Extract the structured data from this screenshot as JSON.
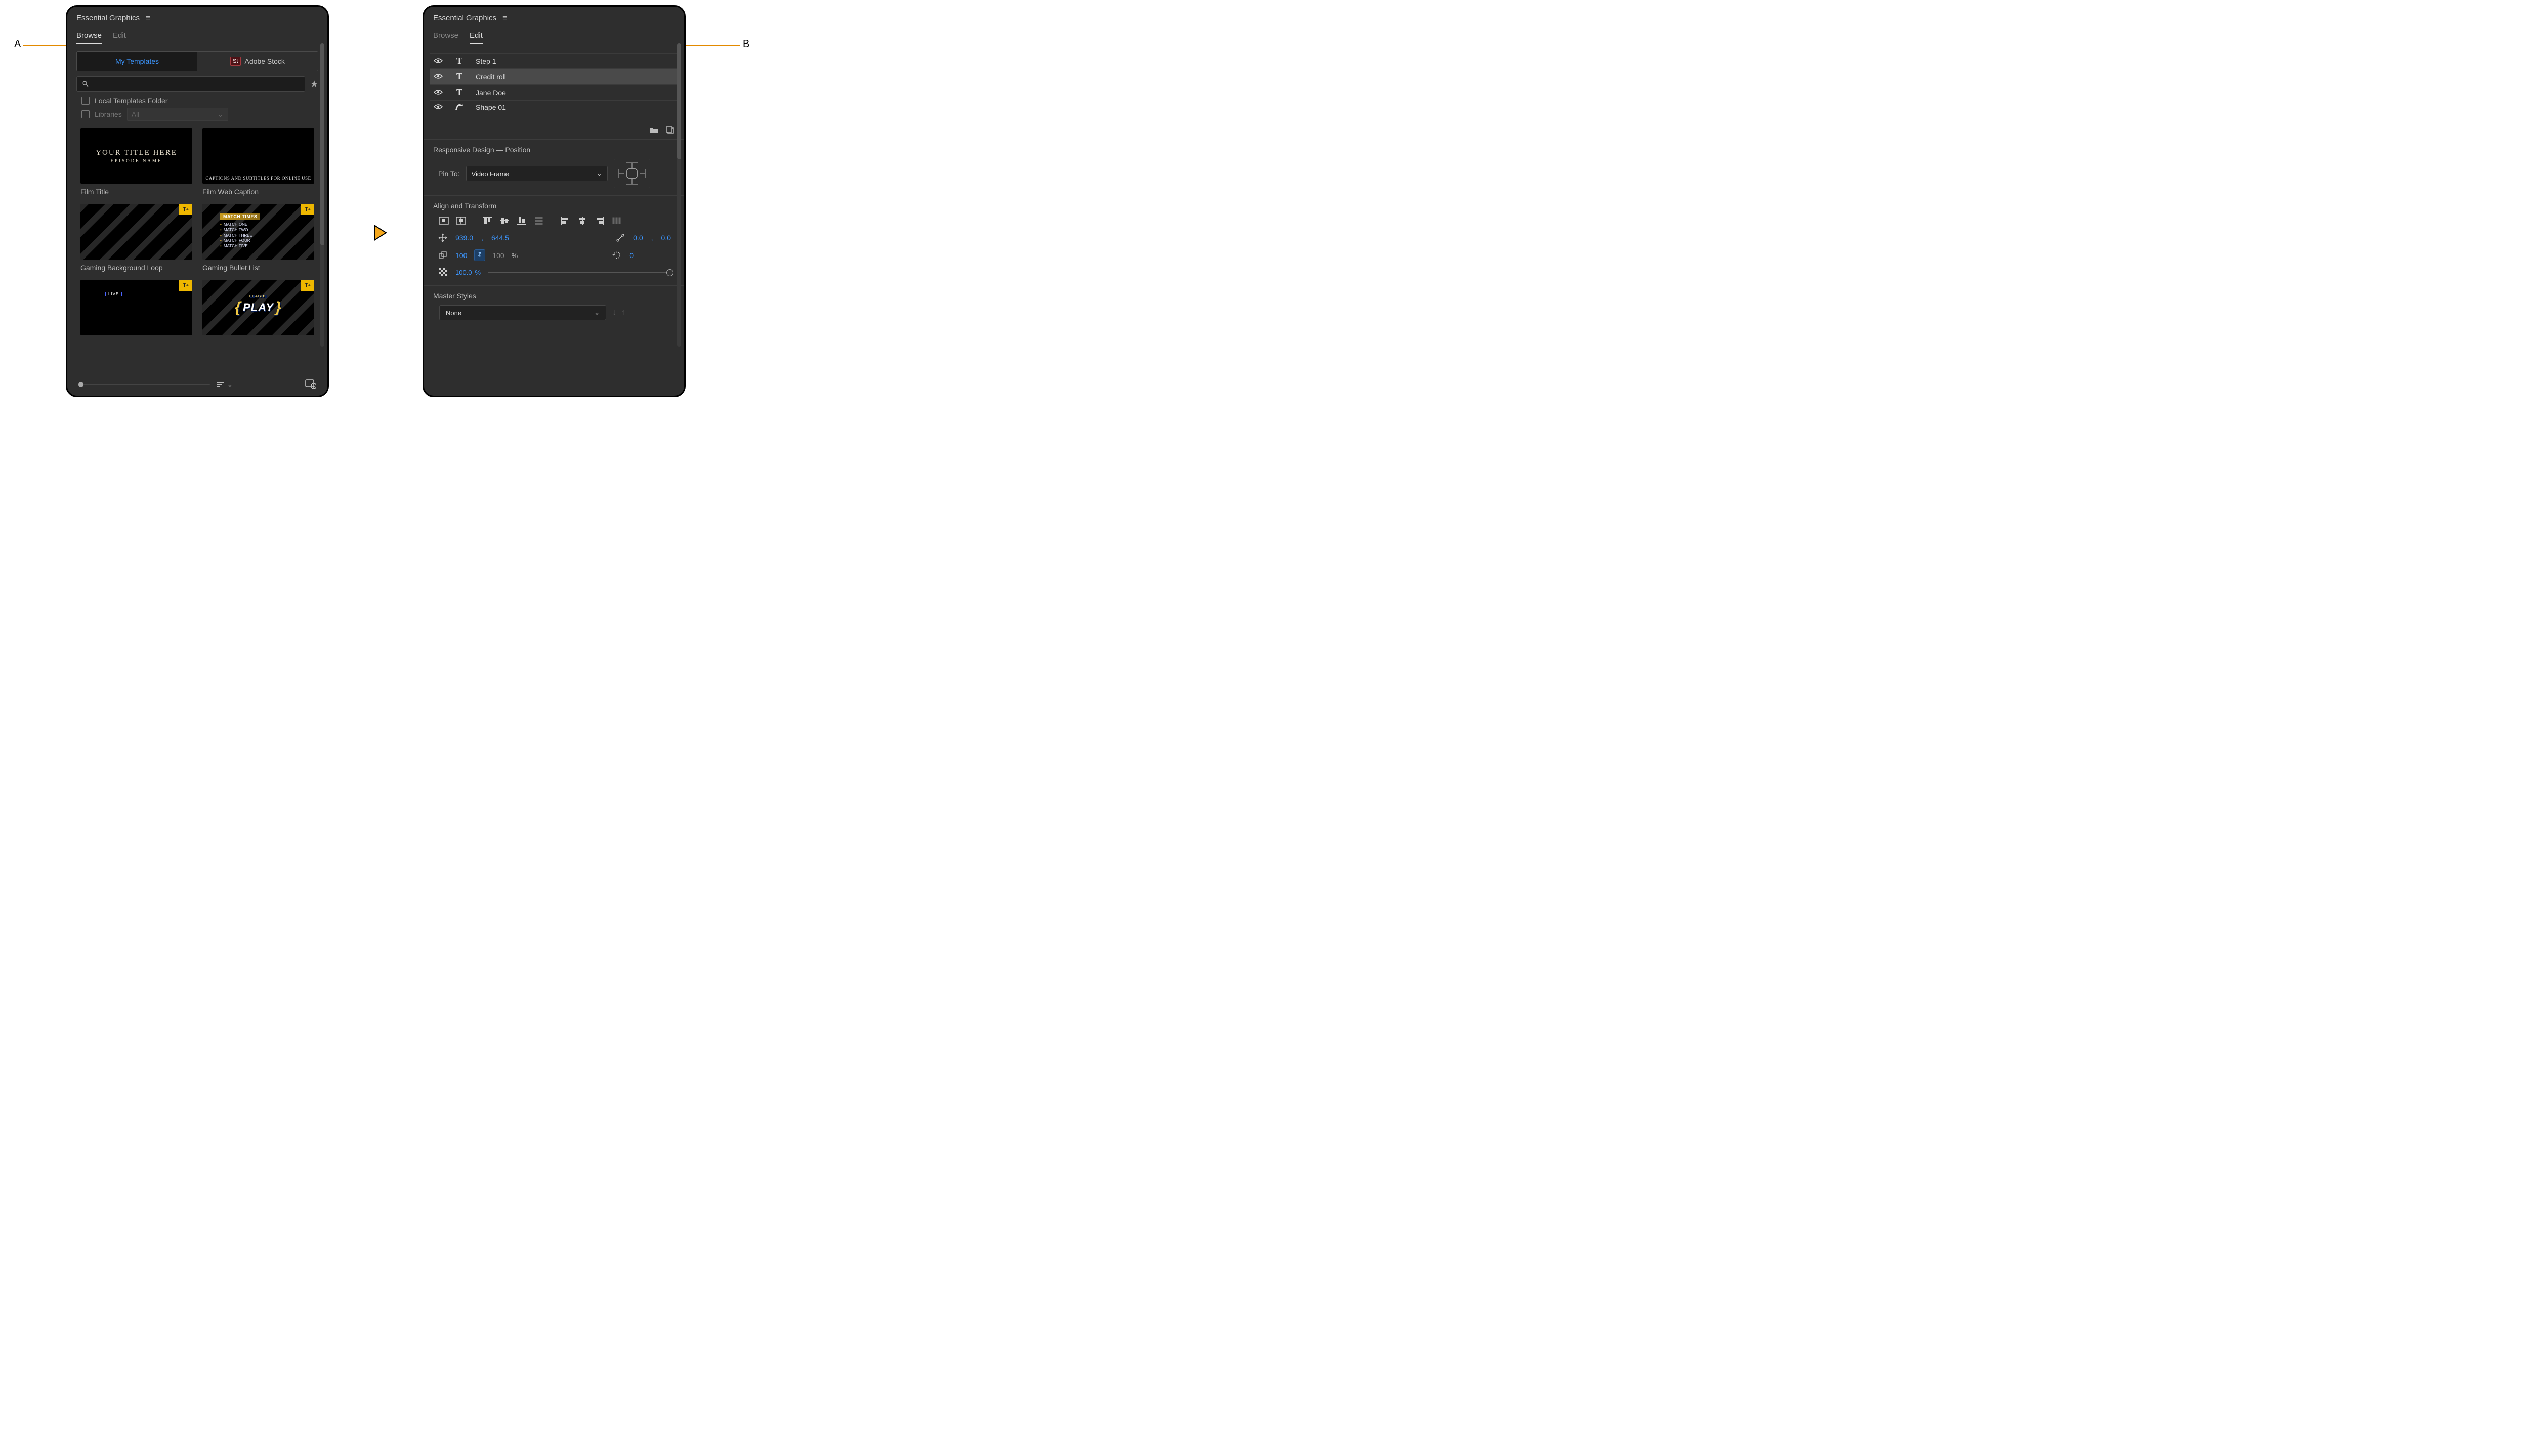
{
  "panel_title": "Essential Graphics",
  "callouts": {
    "a": "A",
    "b": "B"
  },
  "tabs": {
    "browse": "Browse",
    "edit": "Edit"
  },
  "segments": {
    "my_templates": "My Templates",
    "adobe_stock": "Adobe Stock",
    "stock_badge": "St"
  },
  "search_placeholder": "",
  "filters": {
    "local_folder": "Local Templates Folder",
    "libraries": "Libraries",
    "libraries_select": "All"
  },
  "thumbnails": [
    {
      "label": "Film Title",
      "type": "film-title",
      "line1": "YOUR TITLE HERE",
      "line2": "EPISODE NAME"
    },
    {
      "label": "Film Web Caption",
      "type": "web-caption",
      "text": "CAPTIONS AND SUBTITLES FOR ONLINE USE"
    },
    {
      "label": "Gaming Background Loop",
      "type": "blue",
      "badge": true
    },
    {
      "label": "Gaming Bullet List",
      "type": "bullet",
      "badge": true,
      "header": "MATCH TIMES",
      "items": [
        "MATCH ONE",
        "MATCH TWO",
        "MATCH THREE",
        "MATCH FOUR",
        "MATCH FIVE"
      ]
    },
    {
      "label": "",
      "type": "live",
      "badge": true,
      "tag": "LIVE"
    },
    {
      "label": "",
      "type": "play",
      "badge": true,
      "small": "LEAGUE",
      "word": "PLAY"
    }
  ],
  "layers": [
    {
      "name": "Step 1",
      "kind": "text",
      "selected": false
    },
    {
      "name": "Credit roll",
      "kind": "text",
      "selected": true
    },
    {
      "name": "Jane Doe",
      "kind": "text",
      "selected": false
    },
    {
      "name": "Shape 01",
      "kind": "shape",
      "selected": false
    }
  ],
  "sections": {
    "responsive": {
      "title": "Responsive Design — Position",
      "pin_label": "Pin To:",
      "pin_value": "Video Frame"
    },
    "align": {
      "title": "Align and Transform",
      "position_x": "939.0",
      "position_y": "644.5",
      "anchor_x": "0.0",
      "anchor_y": "0.0",
      "scale_w": "100",
      "scale_h": "100",
      "scale_unit": "%",
      "rotation": "0",
      "opacity": "100.0",
      "opacity_unit": "%"
    },
    "master": {
      "title": "Master Styles",
      "value": "None"
    }
  }
}
